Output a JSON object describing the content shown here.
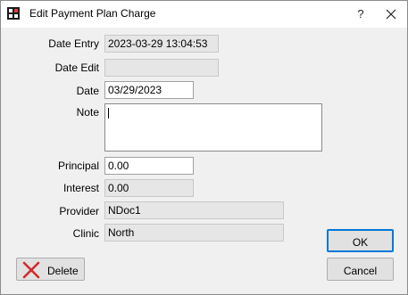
{
  "window": {
    "title": "Edit Payment Plan Charge",
    "help_label": "?",
    "icon": "grid-app-icon"
  },
  "form": {
    "date_entry": {
      "label": "Date Entry",
      "value": "2023-03-29 13:04:53"
    },
    "date_edit": {
      "label": "Date Edit",
      "value": ""
    },
    "date": {
      "label": "Date",
      "value": "03/29/2023"
    },
    "note": {
      "label": "Note",
      "value": ""
    },
    "principal": {
      "label": "Principal",
      "value": "0.00"
    },
    "interest": {
      "label": "Interest",
      "value": "0.00"
    },
    "provider": {
      "label": "Provider",
      "value": "NDoc1"
    },
    "clinic": {
      "label": "Clinic",
      "value": "North"
    }
  },
  "buttons": {
    "ok": "OK",
    "cancel": "Cancel",
    "delete": "Delete"
  },
  "colors": {
    "delete_icon": "#d12a2a",
    "default_button_border": "#0078d7",
    "dialog_background": "#f0f0f0"
  }
}
